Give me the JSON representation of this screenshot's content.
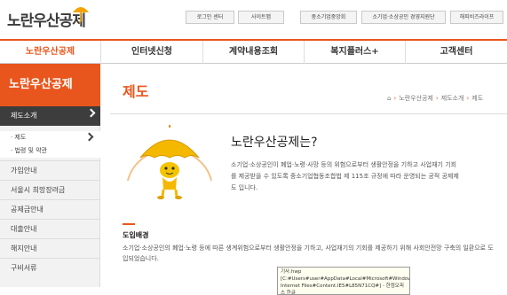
{
  "header": {
    "logo_text": "노란우산공제",
    "util_links": [
      "로그인 센터",
      "사이트맵",
      "중소기업중앙회",
      "소기업·소상공인 경영지원단",
      "해피비즈라이프"
    ]
  },
  "gnb": {
    "items": [
      "노란우산공제",
      "인터넷신청",
      "계약내용조회",
      "복지플러스+",
      "고객센터"
    ],
    "active_index": 0
  },
  "sidebar": {
    "title": "노란우산공제",
    "current": "제도소개",
    "subitems": [
      "· 제도",
      "· 법령 및 약관"
    ],
    "items": [
      "가입안내",
      "서울시 희망장려금",
      "공제금안내",
      "대출안내",
      "해지안내",
      "구비서류"
    ]
  },
  "main": {
    "title": "제도",
    "breadcrumb": [
      "노란우산공제",
      "제도소개",
      "제도"
    ],
    "intro_title": "노란우산공제는?",
    "intro_text": "소기업·소상공인이 폐업·노령·사망 등의 위험으로부터 생활안정을 기하고 사업재기 기회를 제공받을 수 있도록 중소기업협동조합법 제 115조 규정에 따라 운영되는 공적 공제제도 입니다.",
    "section_title": "도입배경",
    "section_text": "소기업·소상공인의 폐업·노령 등에 따른 생계위험으로부터 생활안정을 기하고, 사업재기의 기회를 제공하기 위해 사회안전망 구축의 일환으로 도입되었습니다.",
    "tooltip": "기사.hwp [C:#Users#user#AppData#Local#Microsoft#Windows#Temporary Internet Files#Content.IE5#L85N71CQ#] - 한컴오피스 한글"
  },
  "colors": {
    "accent": "#e9561d",
    "dark": "#3d3d3d",
    "mascot": "#f5b800"
  }
}
